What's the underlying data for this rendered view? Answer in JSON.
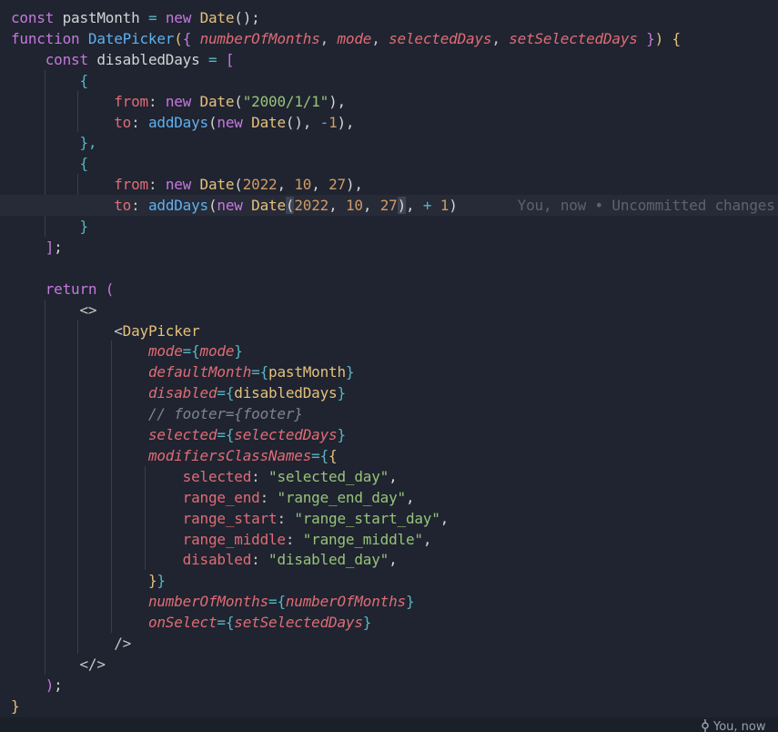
{
  "code_lines": [
    [
      [
        "kw",
        "const "
      ],
      [
        "plain",
        "pastMonth "
      ],
      [
        "op",
        "= "
      ],
      [
        "kw",
        "new "
      ],
      [
        "var",
        "Date"
      ],
      [
        "plain",
        "();"
      ]
    ],
    [
      [
        "kw",
        "function "
      ],
      [
        "fn",
        "DatePicker"
      ],
      [
        "bracket1",
        "("
      ],
      [
        "bracket2",
        "{ "
      ],
      [
        "param",
        "numberOfMonths"
      ],
      [
        "punc",
        ", "
      ],
      [
        "param",
        "mode"
      ],
      [
        "punc",
        ", "
      ],
      [
        "param",
        "selectedDays"
      ],
      [
        "punc",
        ", "
      ],
      [
        "param",
        "setSelectedDays"
      ],
      [
        "bracket2",
        " }"
      ],
      [
        "bracket1",
        ") "
      ],
      [
        "bracket1",
        "{"
      ]
    ],
    [
      [
        "plain",
        "    "
      ],
      [
        "kw",
        "const "
      ],
      [
        "plain",
        "disabledDays "
      ],
      [
        "op",
        "= "
      ],
      [
        "bracket2",
        "["
      ]
    ],
    [
      [
        "plain",
        "        "
      ],
      [
        "bracket3",
        "{"
      ]
    ],
    [
      [
        "plain",
        "            "
      ],
      [
        "prop",
        "from"
      ],
      [
        "punc",
        ": "
      ],
      [
        "kw",
        "new "
      ],
      [
        "var",
        "Date"
      ],
      [
        "plain",
        "("
      ],
      [
        "str",
        "\"2000/1/1\""
      ],
      [
        "plain",
        "),"
      ]
    ],
    [
      [
        "plain",
        "            "
      ],
      [
        "prop",
        "to"
      ],
      [
        "punc",
        ": "
      ],
      [
        "fn",
        "addDays"
      ],
      [
        "plain",
        "("
      ],
      [
        "kw",
        "new "
      ],
      [
        "var",
        "Date"
      ],
      [
        "plain",
        "(), "
      ],
      [
        "op",
        "-"
      ],
      [
        "num",
        "1"
      ],
      [
        "plain",
        "),"
      ]
    ],
    [
      [
        "plain",
        "        "
      ],
      [
        "bracket3",
        "},"
      ]
    ],
    [
      [
        "plain",
        "        "
      ],
      [
        "bracket3",
        "{"
      ]
    ],
    [
      [
        "plain",
        "            "
      ],
      [
        "prop",
        "from"
      ],
      [
        "punc",
        ": "
      ],
      [
        "kw",
        "new "
      ],
      [
        "var",
        "Date"
      ],
      [
        "plain",
        "("
      ],
      [
        "num",
        "2022"
      ],
      [
        "plain",
        ", "
      ],
      [
        "num",
        "10"
      ],
      [
        "plain",
        ", "
      ],
      [
        "num",
        "27"
      ],
      [
        "plain",
        "),"
      ]
    ],
    [
      [
        "plain",
        "            "
      ],
      [
        "prop",
        "to"
      ],
      [
        "punc",
        ": "
      ],
      [
        "fn",
        "addDays"
      ],
      [
        "plain",
        "("
      ],
      [
        "kw",
        "new "
      ],
      [
        "var",
        "Date"
      ],
      [
        "sel",
        "("
      ],
      [
        "num",
        "2022"
      ],
      [
        "plain",
        ", "
      ],
      [
        "num",
        "10"
      ],
      [
        "plain",
        ", "
      ],
      [
        "num",
        "27"
      ],
      [
        "sel",
        ")"
      ],
      [
        "plain",
        ", "
      ],
      [
        "op",
        "+ "
      ],
      [
        "num",
        "1"
      ],
      [
        "plain",
        ")"
      ],
      [
        "blame",
        "       You, now • Uncommitted changes"
      ]
    ],
    [
      [
        "plain",
        "        "
      ],
      [
        "bracket3",
        "}"
      ]
    ],
    [
      [
        "plain",
        "    "
      ],
      [
        "bracket2",
        "]"
      ],
      [
        "plain",
        ";"
      ]
    ],
    [
      [
        "plain",
        ""
      ]
    ],
    [
      [
        "plain",
        "    "
      ],
      [
        "kw",
        "return "
      ],
      [
        "bracket2",
        "("
      ]
    ],
    [
      [
        "plain",
        "        "
      ],
      [
        "punc",
        "<>"
      ]
    ],
    [
      [
        "plain",
        "            "
      ],
      [
        "punc",
        "<"
      ],
      [
        "tag",
        "DayPicker"
      ]
    ],
    [
      [
        "plain",
        "                "
      ],
      [
        "attr",
        "mode"
      ],
      [
        "op",
        "="
      ],
      [
        "bracket3",
        "{"
      ],
      [
        "param",
        "mode"
      ],
      [
        "bracket3",
        "}"
      ]
    ],
    [
      [
        "plain",
        "                "
      ],
      [
        "attr",
        "defaultMonth"
      ],
      [
        "op",
        "="
      ],
      [
        "bracket3",
        "{"
      ],
      [
        "var",
        "pastMonth"
      ],
      [
        "bracket3",
        "}"
      ]
    ],
    [
      [
        "plain",
        "                "
      ],
      [
        "attr",
        "disabled"
      ],
      [
        "op",
        "="
      ],
      [
        "bracket3",
        "{"
      ],
      [
        "var",
        "disabledDays"
      ],
      [
        "bracket3",
        "}"
      ]
    ],
    [
      [
        "plain",
        "                "
      ],
      [
        "comment",
        "// footer={footer}"
      ]
    ],
    [
      [
        "plain",
        "                "
      ],
      [
        "attr",
        "selected"
      ],
      [
        "op",
        "="
      ],
      [
        "bracket3",
        "{"
      ],
      [
        "param",
        "selectedDays"
      ],
      [
        "bracket3",
        "}"
      ]
    ],
    [
      [
        "plain",
        "                "
      ],
      [
        "attr",
        "modifiersClassNames"
      ],
      [
        "op",
        "="
      ],
      [
        "bracket3",
        "{"
      ],
      [
        "bracket1",
        "{"
      ]
    ],
    [
      [
        "plain",
        "                    "
      ],
      [
        "prop",
        "selected"
      ],
      [
        "punc",
        ": "
      ],
      [
        "str",
        "\"selected_day\""
      ],
      [
        "plain",
        ","
      ]
    ],
    [
      [
        "plain",
        "                    "
      ],
      [
        "prop",
        "range_end"
      ],
      [
        "punc",
        ": "
      ],
      [
        "str",
        "\"range_end_day\""
      ],
      [
        "plain",
        ","
      ]
    ],
    [
      [
        "plain",
        "                    "
      ],
      [
        "prop",
        "range_start"
      ],
      [
        "punc",
        ": "
      ],
      [
        "str",
        "\"range_start_day\""
      ],
      [
        "plain",
        ","
      ]
    ],
    [
      [
        "plain",
        "                    "
      ],
      [
        "prop",
        "range_middle"
      ],
      [
        "punc",
        ": "
      ],
      [
        "str",
        "\"range_middle\""
      ],
      [
        "plain",
        ","
      ]
    ],
    [
      [
        "plain",
        "                    "
      ],
      [
        "prop",
        "disabled"
      ],
      [
        "punc",
        ": "
      ],
      [
        "str",
        "\"disabled_day\""
      ],
      [
        "plain",
        ","
      ]
    ],
    [
      [
        "plain",
        "                "
      ],
      [
        "bracket1",
        "}"
      ],
      [
        "bracket3",
        "}"
      ]
    ],
    [
      [
        "plain",
        "                "
      ],
      [
        "attr",
        "numberOfMonths"
      ],
      [
        "op",
        "="
      ],
      [
        "bracket3",
        "{"
      ],
      [
        "param",
        "numberOfMonths"
      ],
      [
        "bracket3",
        "}"
      ]
    ],
    [
      [
        "plain",
        "                "
      ],
      [
        "attr",
        "onSelect"
      ],
      [
        "op",
        "="
      ],
      [
        "bracket3",
        "{"
      ],
      [
        "param",
        "setSelectedDays"
      ],
      [
        "bracket3",
        "}"
      ]
    ],
    [
      [
        "plain",
        "            "
      ],
      [
        "punc",
        "/>"
      ]
    ],
    [
      [
        "plain",
        "        "
      ],
      [
        "punc",
        "</>"
      ]
    ],
    [
      [
        "plain",
        "    "
      ],
      [
        "bracket2",
        ")"
      ],
      [
        "plain",
        ";"
      ]
    ],
    [
      [
        "bracket1",
        "}"
      ]
    ]
  ],
  "statusbar": {
    "git_blame": "You, now"
  }
}
